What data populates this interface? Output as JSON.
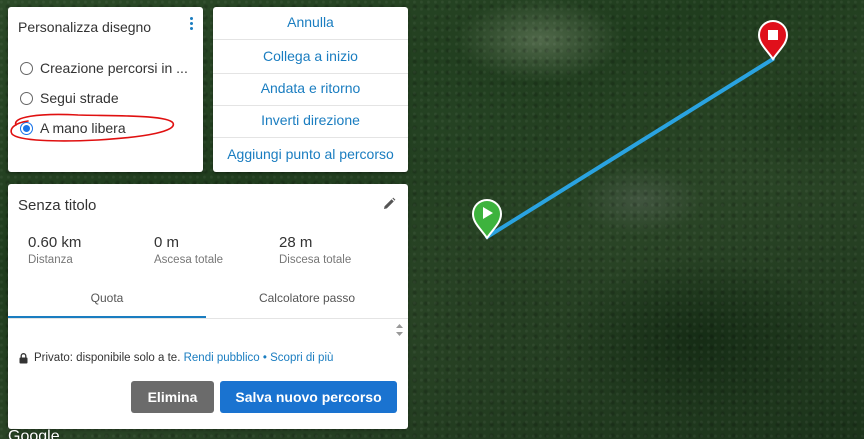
{
  "draw_panel": {
    "title": "Personalizza disegno",
    "options": [
      {
        "label": "Creazione percorsi in ...",
        "checked": false
      },
      {
        "label": "Segui strade",
        "checked": false
      },
      {
        "label": "A mano libera",
        "checked": true
      }
    ]
  },
  "action_menu": {
    "items": [
      "Annulla",
      "Collega a inizio",
      "Andata e ritorno",
      "Inverti direzione",
      "Aggiungi punto al percorso"
    ]
  },
  "route": {
    "title": "Senza titolo",
    "stats": [
      {
        "value": "0.60 km",
        "label": "Distanza"
      },
      {
        "value": "0 m",
        "label": "Ascesa totale"
      },
      {
        "value": "28 m",
        "label": "Discesa totale"
      }
    ],
    "tabs": [
      "Quota",
      "Calcolatore passo"
    ],
    "active_tab": "Quota",
    "privacy_text": "Privato: disponibile solo a te.",
    "privacy_link_public": "Rendi pubblico",
    "privacy_separator": "•",
    "privacy_link_more": "Scopri di più",
    "delete_label": "Elimina",
    "save_label": "Salva nuovo percorso"
  },
  "map": {
    "attribution": "Google",
    "route_color": "#2aa3e0",
    "start_marker_color": "#3db33d",
    "end_marker_color": "#e0101b"
  }
}
